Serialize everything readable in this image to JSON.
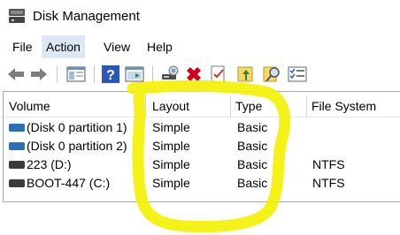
{
  "window": {
    "title": "Disk Management"
  },
  "menu": [
    "File",
    "Action",
    "View",
    "Help"
  ],
  "toolbar": {
    "icons": [
      "back-arrow-icon",
      "forward-arrow-icon",
      "console-tree-icon",
      "help-icon",
      "properties-icon",
      "connect-icon",
      "delete-icon",
      "checklist-icon",
      "new-folder-icon",
      "search-icon",
      "settings-list-icon"
    ]
  },
  "table": {
    "columns": [
      "Volume",
      "Layout",
      "Type",
      "File System"
    ],
    "rows": [
      {
        "volume": "(Disk 0 partition 1)",
        "layout": "Simple",
        "type": "Basic",
        "fs": ""
      },
      {
        "volume": "(Disk 0 partition 2)",
        "layout": "Simple",
        "type": "Basic",
        "fs": ""
      },
      {
        "volume": "223 (D:)",
        "layout": "Simple",
        "type": "Basic",
        "fs": "NTFS"
      },
      {
        "volume": "BOOT-447 (C:)",
        "layout": "Simple",
        "type": "Basic",
        "fs": "NTFS"
      }
    ]
  },
  "colors": {
    "highlight": "#f4f100",
    "disk_icon_blue": "#2a6fb8",
    "disk_icon_dark": "#3c3c3c",
    "menu_active": "#dbe7f5"
  }
}
